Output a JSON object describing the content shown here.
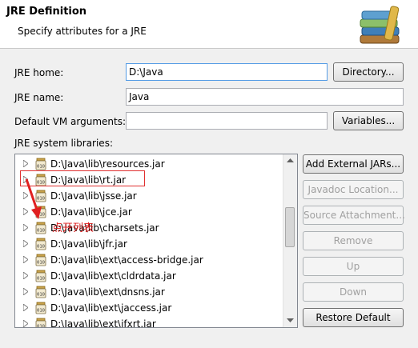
{
  "header": {
    "title": "JRE Definition",
    "subtitle": "Specify attributes for a JRE",
    "icon": "books-icon"
  },
  "form": {
    "jre_home_label": "JRE home:",
    "jre_home_value": "D:\\Java",
    "jre_name_label": "JRE name:",
    "jre_name_value": "Java",
    "vm_args_label": "Default VM arguments:",
    "vm_args_value": "",
    "libraries_label": "JRE system libraries:"
  },
  "buttons": {
    "directory": "Directory...",
    "variables": "Variables...",
    "add_external_jars": "Add External JARs...",
    "javadoc_location": "Javadoc Location...",
    "source_attachment": "Source Attachment...",
    "remove": "Remove",
    "up": "Up",
    "down": "Down",
    "restore_default": "Restore Default"
  },
  "libraries": [
    {
      "label": "D:\\Java\\lib\\resources.jar"
    },
    {
      "label": "D:\\Java\\lib\\rt.jar"
    },
    {
      "label": "D:\\Java\\lib\\jsse.jar"
    },
    {
      "label": "D:\\Java\\lib\\jce.jar"
    },
    {
      "label": "D:\\Java\\lib\\charsets.jar"
    },
    {
      "label": "D:\\Java\\lib\\jfr.jar"
    },
    {
      "label": "D:\\Java\\lib\\ext\\access-bridge.jar"
    },
    {
      "label": "D:\\Java\\lib\\ext\\cldrdata.jar"
    },
    {
      "label": "D:\\Java\\lib\\ext\\dnsns.jar"
    },
    {
      "label": "D:\\Java\\lib\\ext\\jaccess.jar"
    },
    {
      "label": "D:\\Java\\lib\\ext\\jfxrt.jar"
    }
  ],
  "annotation": {
    "text": "点开列表",
    "color": "#e02020"
  }
}
